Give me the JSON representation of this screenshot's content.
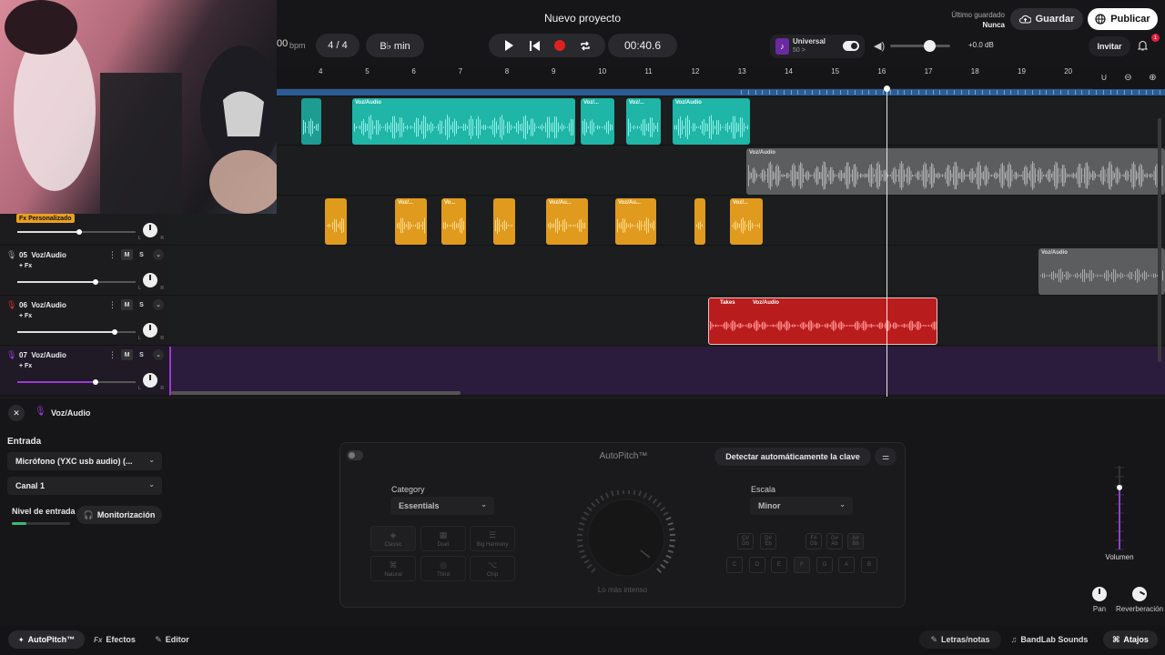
{
  "header": {
    "project_title": "Nuevo proyecto",
    "bpm_value": "00",
    "bpm_unit": "bpm",
    "time_signature": "4 / 4",
    "key": "B♭ min",
    "time": "00:40.6",
    "universal_title": "Universal",
    "universal_sub": "50 >",
    "master_db": "+0.0 dB",
    "last_saved_label": "Último guardado",
    "last_saved_value": "Nunca",
    "save_label": "Guardar",
    "publish_label": "Publicar",
    "invite_label": "Invitar",
    "notification_count": "1"
  },
  "ruler": {
    "bars": [
      "4",
      "5",
      "6",
      "7",
      "8",
      "9",
      "10",
      "11",
      "12",
      "13",
      "14",
      "15",
      "16",
      "17",
      "18",
      "19",
      "20"
    ]
  },
  "tracks": [
    {
      "number": "05",
      "name": "Voz/Audio",
      "mute": "M",
      "solo": "S",
      "fx": "+ Fx",
      "volume": 0.66,
      "color": "#9a9a9a"
    },
    {
      "number": "06",
      "name": "Voz/Audio",
      "mute": "M",
      "solo": "S",
      "fx": "+ Fx",
      "volume": 0.82,
      "color": "#d42a2a"
    },
    {
      "number": "07",
      "name": "Voz/Audio",
      "mute": "M",
      "solo": "S",
      "fx": "+ Fx",
      "volume": 0.66,
      "color": "#9a3ad8"
    }
  ],
  "track04": {
    "fx_tag": "Fx Personalizado",
    "volume": 0.52
  },
  "clips": {
    "teal": [
      "Voz/Audio",
      "Voz/...",
      "Voz/...",
      "Voz/Audio"
    ],
    "grey1": "Voz/Audio",
    "orange": [
      "Voz/...",
      "Vo...",
      "Voz/Au...",
      "Voz/Au...",
      "Voz/..."
    ],
    "grey2": "Voz/Audio",
    "red_takes": "Takes",
    "red_title": "Voz/Audio"
  },
  "bottom_panel": {
    "track_title": "Voz/Audio",
    "input_label": "Entrada",
    "input_device": "Micrófono (YXC usb audio) (...",
    "channel": "Canal 1",
    "input_level_label": "Nivel de entrada",
    "input_level": 0.25,
    "monitoring_label": "Monitorización"
  },
  "autopitch": {
    "title": "AutoPitch™",
    "detect_label": "Detectar automáticamente la clave",
    "category_label": "Category",
    "category_value": "Essentials",
    "scale_label": "Escala",
    "scale_value": "Minor",
    "presets": [
      "Classic",
      "Duet",
      "Big Harmony",
      "Natural",
      "Third",
      "Chip"
    ],
    "dial_label": "Lo más intenso",
    "sharp_keys": [
      "C#\nDb",
      "D#\nEb",
      "F#\nGb",
      "G#\nAb",
      "A#\nBb"
    ],
    "natural_keys": [
      "C",
      "D",
      "E",
      "F",
      "G",
      "A",
      "B"
    ]
  },
  "right_panel": {
    "volume_label": "Volumen",
    "volume": 0.74,
    "pan_label": "Pan",
    "reverb_label": "Reverberación"
  },
  "bottom_bar": {
    "autopitch_label": "AutoPitch™",
    "effects_label": "Efectos",
    "editor_label": "Editor",
    "lyrics_label": "Letras/notas",
    "sounds_label": "BandLab Sounds",
    "shortcuts_label": "Atajos"
  }
}
